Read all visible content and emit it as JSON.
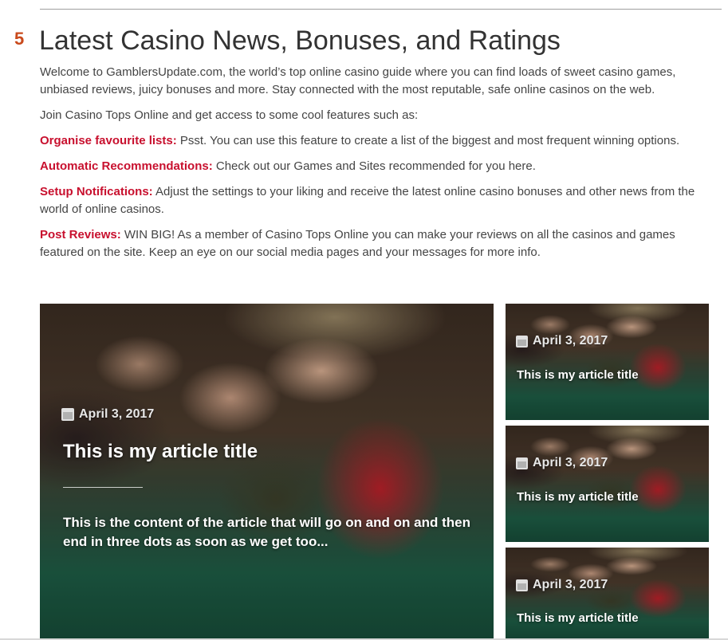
{
  "section": {
    "number": "5",
    "title": "Latest Casino News, Bonuses, and Ratings"
  },
  "intro": {
    "welcome": "Welcome to GamblersUpdate.com, the world’s top online casino guide where you can find loads of sweet casino games, unbiased reviews, juicy bonuses and more. Stay connected with the most reputable, safe online casinos on the web.",
    "join": "Join Casino Tops Online and get access to some cool features such as:"
  },
  "features": [
    {
      "label": "Organise favourite lists:",
      "text": " Psst. You can use this feature to create a list of the biggest and most frequent winning options."
    },
    {
      "label": "Automatic Recommendations:",
      "text": " Check out our Games and Sites recommended for you here."
    },
    {
      "label": "Setup Notifications:",
      "text": " Adjust the settings to your liking and receive the latest online casino bonuses and other news from the world of online casinos."
    },
    {
      "label": "Post Reviews:",
      "text": " WIN BIG! As a member of Casino Tops Online you can make your reviews on all the casinos and games featured on the site. Keep an eye on our social media pages and your messages for more info."
    }
  ],
  "featured_article": {
    "date": "April 3, 2017",
    "title": "This is my article title",
    "excerpt": "This is the content of the article that will go on and on and then end in three dots as soon as we get too..."
  },
  "side_articles": [
    {
      "date": "April 3, 2017",
      "title": "This is my article title"
    },
    {
      "date": "April 3, 2017",
      "title": "This is my article title"
    },
    {
      "date": "April 3, 2017",
      "title": "This is my article title"
    }
  ],
  "colors": {
    "accent_red": "#c8102e",
    "number_orange": "#c94a1c"
  },
  "icons": {
    "date": "calendar-icon"
  }
}
